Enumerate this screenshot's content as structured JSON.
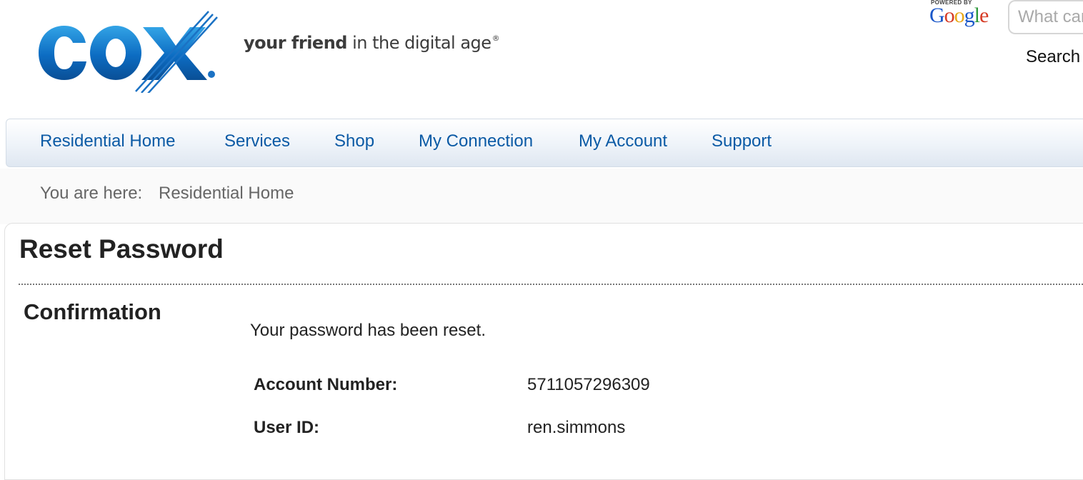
{
  "header": {
    "logo_text": "COX",
    "tagline_bold": "your friend",
    "tagline_rest": "in the digital age",
    "tagline_mark": "®",
    "search": {
      "powered_by": "POWERED BY",
      "google_letters": [
        "G",
        "o",
        "o",
        "g",
        "l",
        "e"
      ],
      "placeholder": "What can we help you find?",
      "button_label": "Search"
    }
  },
  "nav": {
    "items": [
      {
        "label": "Residential Home"
      },
      {
        "label": "Services"
      },
      {
        "label": "Shop"
      },
      {
        "label": "My Connection"
      },
      {
        "label": "My Account"
      },
      {
        "label": "Support"
      }
    ]
  },
  "breadcrumb": {
    "label": "You are here:",
    "current": "Residential Home"
  },
  "main": {
    "title": "Reset Password",
    "section_title": "Confirmation",
    "message": "Your password has been reset.",
    "fields": [
      {
        "label": "Account Number:",
        "value": "5711057296309"
      },
      {
        "label": "User ID:",
        "value": "ren.simmons"
      }
    ]
  },
  "colors": {
    "nav_link": "#0b5aa5",
    "logo_blue": "#0b6bbf",
    "heading_text": "#222222",
    "breadcrumb_text": "#666666"
  }
}
